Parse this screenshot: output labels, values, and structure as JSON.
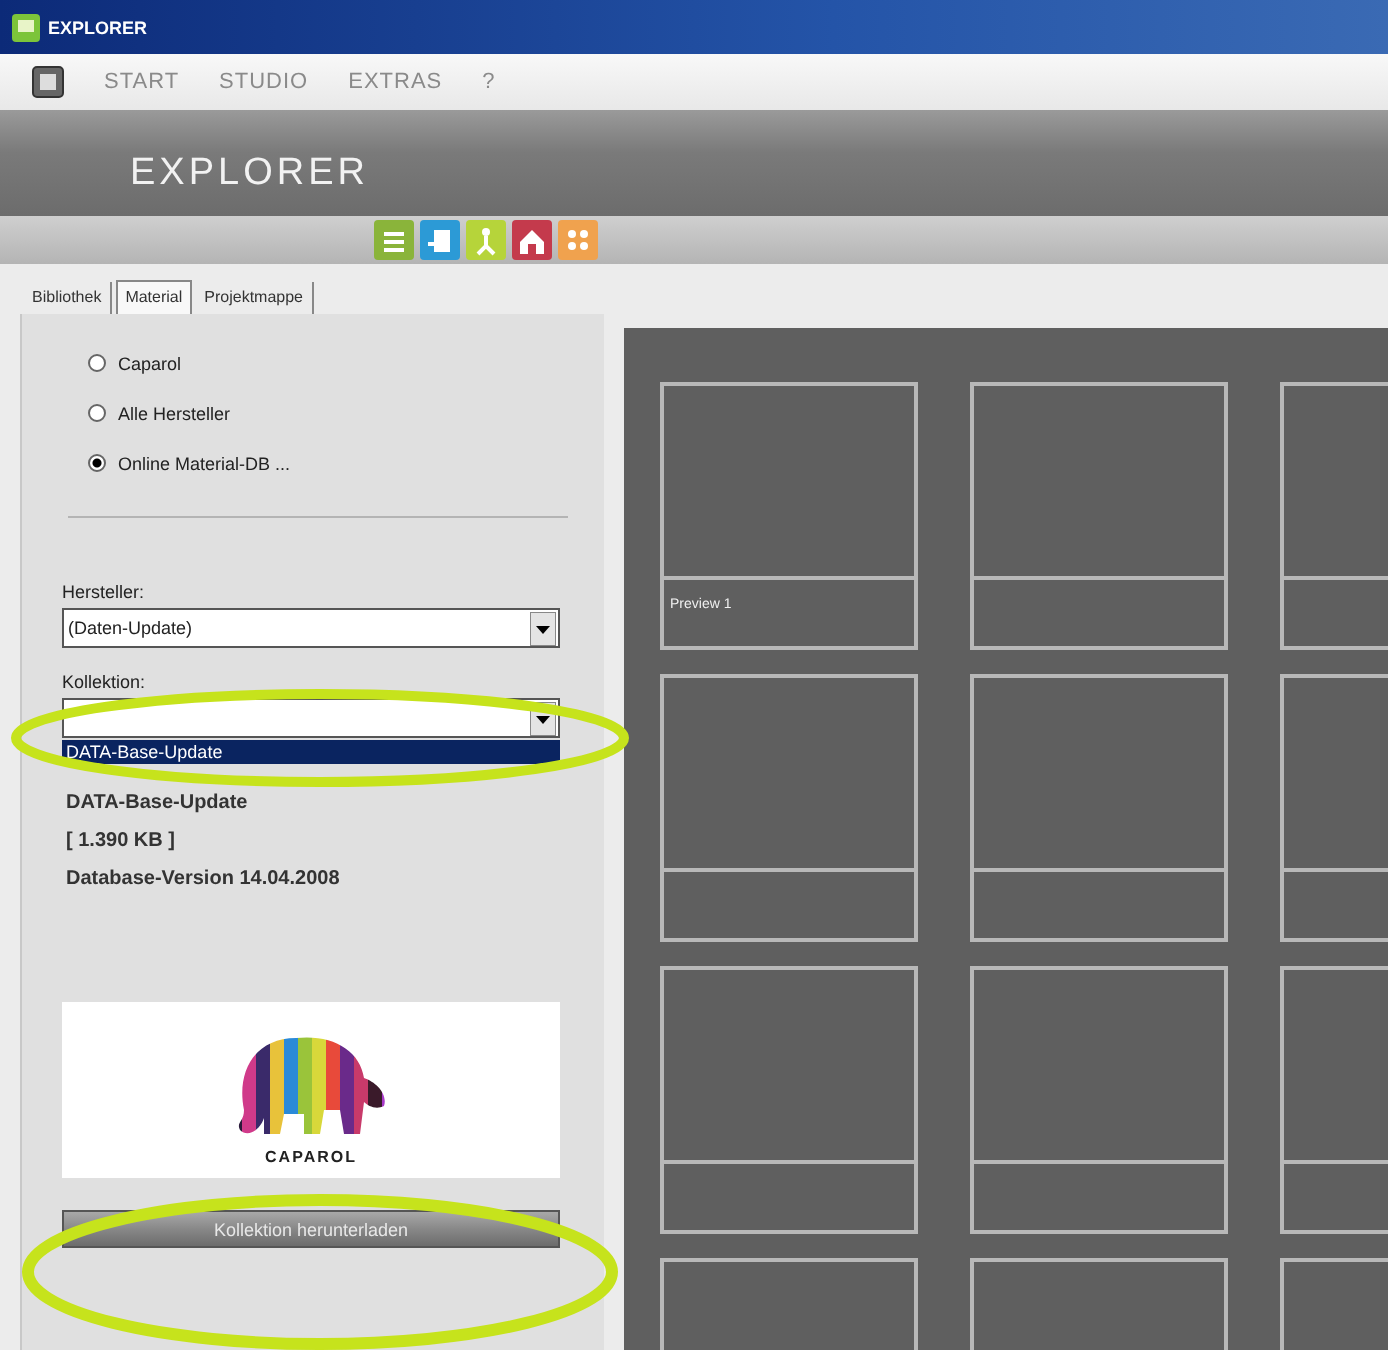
{
  "window": {
    "title": "EXPLORER"
  },
  "menu": [
    {
      "label": "START"
    },
    {
      "label": "STUDIO"
    },
    {
      "label": "EXTRAS"
    },
    {
      "label": "?"
    }
  ],
  "banner": {
    "title": "EXPLORER"
  },
  "tabs": [
    {
      "label": "Bibliothek",
      "selected": false
    },
    {
      "label": "Material",
      "selected": true
    },
    {
      "label": "Projektmappe",
      "selected": false
    }
  ],
  "source_options": [
    {
      "label": "Caparol",
      "selected": false
    },
    {
      "label": "Alle Hersteller",
      "selected": false
    },
    {
      "label": "Online Material-DB ...",
      "selected": true
    }
  ],
  "hersteller": {
    "label": "Hersteller:",
    "value": "(Daten-Update)"
  },
  "kollektion": {
    "label": "Kollektion:",
    "list": [
      {
        "label": "DATA-Base-Update",
        "selected": true
      }
    ]
  },
  "info": [
    "DATA-Base-Update",
    "[ 1.390 KB ]",
    "Database-Version 14.04.2008"
  ],
  "logo": {
    "text": "CAPAROL"
  },
  "download_button": {
    "label": "Kollektion herunterladen"
  },
  "tiles": [
    {
      "kind": "captioned",
      "caption": "Preview 1"
    },
    {
      "kind": "blank"
    },
    {
      "kind": "blank"
    },
    {
      "kind": "blank"
    },
    {
      "kind": "blank"
    },
    {
      "kind": "blank"
    },
    {
      "kind": "blank"
    },
    {
      "kind": "blank"
    },
    {
      "kind": "blank"
    },
    {
      "kind": "blank"
    },
    {
      "kind": "blank"
    },
    {
      "kind": "blank"
    }
  ],
  "annotations": [
    {
      "kind": "ellipse",
      "color": "#c6e31c"
    },
    {
      "kind": "ellipse",
      "color": "#c6e31c"
    }
  ]
}
